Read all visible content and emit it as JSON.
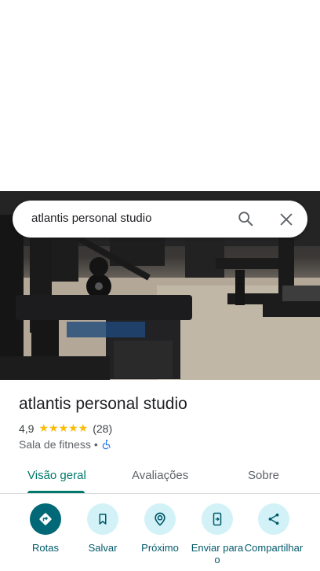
{
  "search": {
    "query": "atlantis personal studio"
  },
  "place": {
    "name": "atlantis personal studio",
    "rating": "4,9",
    "stars": "★★★★★",
    "review_count": "(28)",
    "category": "Sala de fitness",
    "separator": "•"
  },
  "tabs": [
    {
      "label": "Visão geral"
    },
    {
      "label": "Avaliações"
    },
    {
      "label": "Sobre"
    }
  ],
  "actions": [
    {
      "label": "Rotas",
      "icon": "directions-icon"
    },
    {
      "label": "Salvar",
      "icon": "bookmark-icon"
    },
    {
      "label": "Próximo",
      "icon": "nearby-icon"
    },
    {
      "label": "Enviar para o",
      "icon": "send-to-phone-icon"
    },
    {
      "label": "Compartilhar",
      "icon": "share-icon"
    }
  ],
  "colors": {
    "accent": "#00796b",
    "action_bg": "#d2f2f8",
    "action_primary": "#006876",
    "star": "#fbbc04",
    "accessibility": "#1a73e8"
  }
}
